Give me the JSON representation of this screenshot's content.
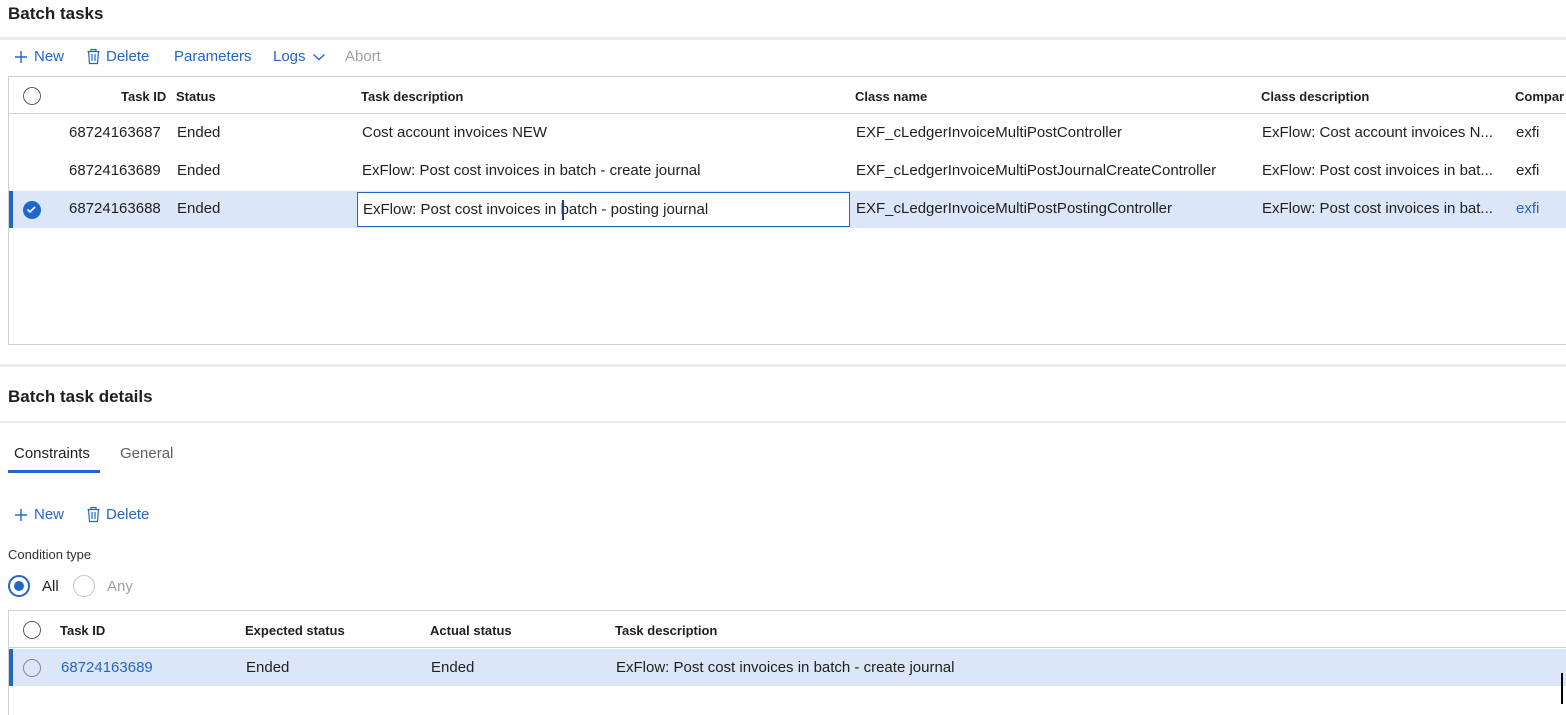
{
  "batch_tasks": {
    "title": "Batch tasks",
    "toolbar": {
      "new_label": "New",
      "delete_label": "Delete",
      "parameters_label": "Parameters",
      "logs_label": "Logs",
      "abort_label": "Abort"
    },
    "columns": {
      "task_id": "Task ID",
      "status": "Status",
      "task_description": "Task description",
      "class_name": "Class name",
      "class_description": "Class description",
      "company": "Compar"
    },
    "rows": [
      {
        "task_id": "68724163687",
        "status": "Ended",
        "task_description": "Cost account invoices NEW",
        "class_name": "EXF_cLedgerInvoiceMultiPostController",
        "class_description": "ExFlow: Cost account invoices N...",
        "company": "exfi"
      },
      {
        "task_id": "68724163689",
        "status": "Ended",
        "task_description": "ExFlow: Post cost invoices in batch - create journal",
        "class_name": "EXF_cLedgerInvoiceMultiPostJournalCreateController",
        "class_description": "ExFlow: Post cost invoices in bat...",
        "company": "exfi"
      },
      {
        "task_id": "68724163688",
        "status": "Ended",
        "task_description": "ExFlow: Post cost invoices in batch - posting journal",
        "class_name": "EXF_cLedgerInvoiceMultiPostPostingController",
        "class_description": "ExFlow: Post cost invoices in bat...",
        "company": "exfi"
      }
    ]
  },
  "batch_task_details": {
    "title": "Batch task details",
    "tabs": [
      {
        "label": "Constraints"
      },
      {
        "label": "General"
      }
    ],
    "toolbar": {
      "new_label": "New",
      "delete_label": "Delete"
    },
    "condition_type": {
      "label": "Condition type",
      "options": [
        {
          "label": "All"
        },
        {
          "label": "Any"
        }
      ],
      "selected": "All"
    },
    "columns": {
      "task_id": "Task ID",
      "expected_status": "Expected status",
      "actual_status": "Actual status",
      "task_description": "Task description"
    },
    "rows": [
      {
        "task_id": "68724163689",
        "expected_status": "Ended",
        "actual_status": "Ended",
        "task_description": "ExFlow: Post cost invoices in batch - create journal"
      }
    ]
  },
  "colors": {
    "accent": "#2266c8",
    "selected_row": "#dbe6f8",
    "disabled": "#a19f9d"
  }
}
